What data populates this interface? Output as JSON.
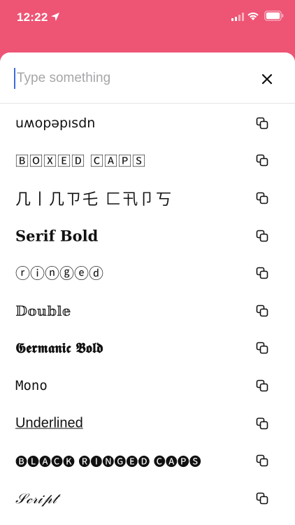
{
  "status_bar": {
    "time": "12:22",
    "background_color": "#ee5474"
  },
  "search": {
    "placeholder": "Type something",
    "value": ""
  },
  "fonts": [
    {
      "name": "upside-down",
      "sample": "uʍopǝpısdn",
      "icon": "copy-icon"
    },
    {
      "name": "boxed-caps",
      "sample": "🄱🄾🅇🄴🄳 🄲🄰🄿🅂",
      "icon": "copy-icon"
    },
    {
      "name": "asian-caps",
      "sample": "几丨几ㄗ乇 匚卂卩丂",
      "icon": "copy-icon"
    },
    {
      "name": "serif-bold",
      "sample": "𝐒𝐞𝐫𝐢𝐟 𝐁𝐨𝐥𝐝",
      "icon": "copy-icon"
    },
    {
      "name": "ringed",
      "sample": "ⓡⓘⓝⓖⓔⓓ",
      "icon": "copy-icon"
    },
    {
      "name": "double",
      "sample": "𝔻𝕠𝕦𝕓𝕝𝕖",
      "icon": "copy-icon"
    },
    {
      "name": "germanic-bold",
      "sample": "𝕲𝖊𝖗𝖒𝖆𝖓𝖎𝖈 𝕭𝖔𝖑𝖉",
      "icon": "copy-icon"
    },
    {
      "name": "mono",
      "sample": "𝙼𝚘𝚗𝚘",
      "icon": "copy-icon"
    },
    {
      "name": "underlined",
      "sample": "Underlined ",
      "icon": "copy-icon"
    },
    {
      "name": "black-ringed-caps",
      "sample": "🅑🅛🅐🅒🅚 🅡🅘🅝🅖🅔🅓 🅒🅐🅟🅢",
      "icon": "copy-icon"
    },
    {
      "name": "script",
      "sample": "𝒮𝒸𝓇𝒾𝓅𝓉",
      "icon": "copy-icon"
    }
  ]
}
